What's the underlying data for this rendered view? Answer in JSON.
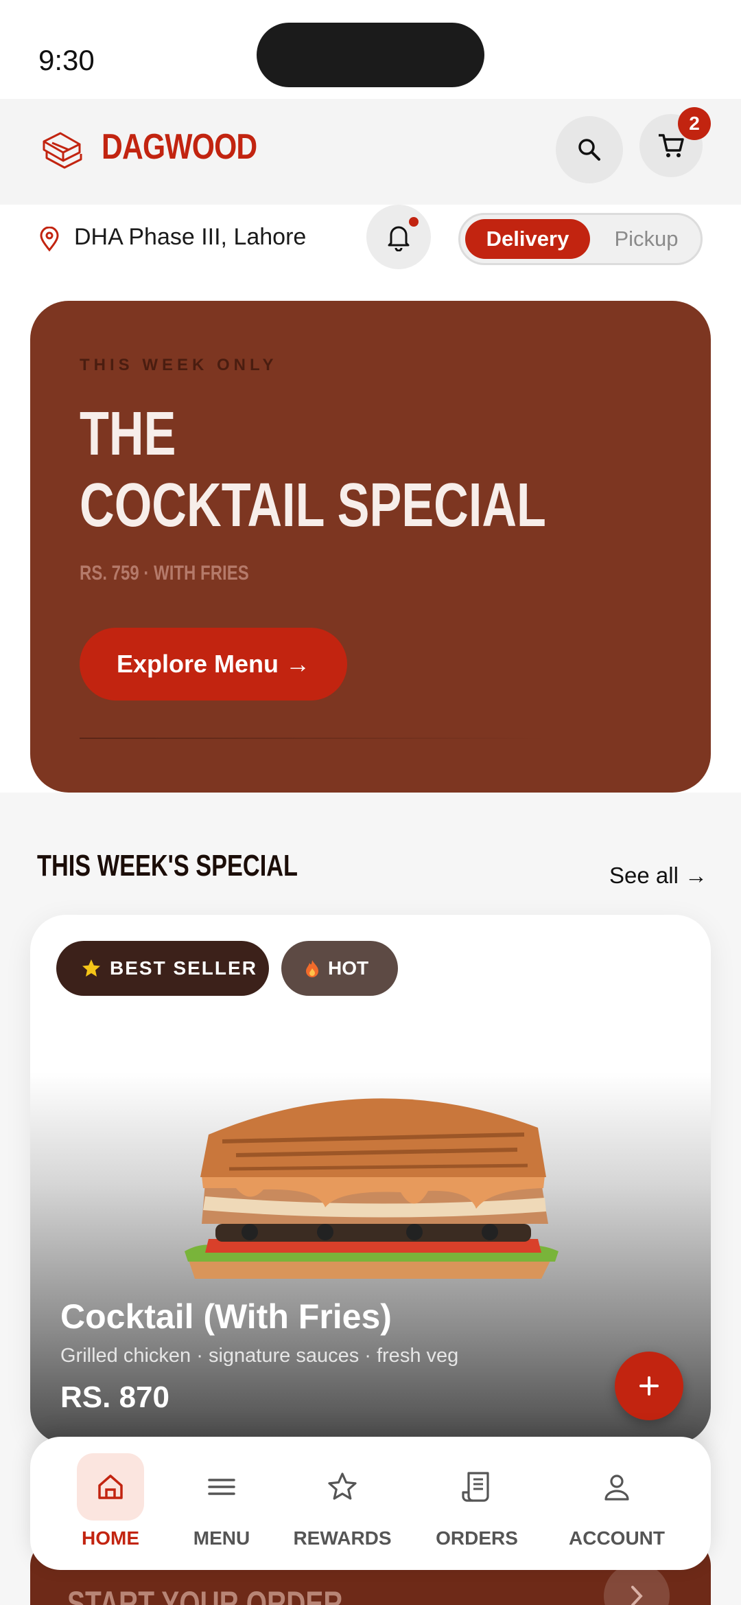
{
  "status_bar": {
    "time": "9:30"
  },
  "header": {
    "brand": "DAGWOOD",
    "cart_count": "2"
  },
  "location": {
    "address": "DHA Phase III, Lahore"
  },
  "mode_toggle": {
    "active": "Delivery",
    "inactive": "Pickup"
  },
  "hero": {
    "eyebrow": "THIS WEEK ONLY",
    "title_line1": "THE",
    "title_line2": "COCKTAIL SPECIAL",
    "price": "RS. 759 · WITH FRIES",
    "cta": "Explore Menu →"
  },
  "section": {
    "title": "THIS WEEK'S SPECIAL",
    "see_all": "See all →"
  },
  "product": {
    "badge_best": "BEST SELLER",
    "badge_hot": "HOT",
    "name": "Cocktail (With Fries)",
    "description": "Grilled chicken · signature sauces · fresh veg",
    "price": "RS. 870"
  },
  "start_order": {
    "label": "START YOUR ORDER"
  },
  "bottom_nav": {
    "items": [
      {
        "label": "HOME",
        "icon": "home-icon",
        "active": true
      },
      {
        "label": "MENU",
        "icon": "menu-icon",
        "active": false
      },
      {
        "label": "REWARDS",
        "icon": "star-icon",
        "active": false
      },
      {
        "label": "ORDERS",
        "icon": "receipt-icon",
        "active": false
      },
      {
        "label": "ACCOUNT",
        "icon": "user-icon",
        "active": false
      }
    ]
  },
  "colors": {
    "brand_red": "#c22410",
    "hero_brown": "#7d3621",
    "dark_chip": "#3c211a"
  }
}
